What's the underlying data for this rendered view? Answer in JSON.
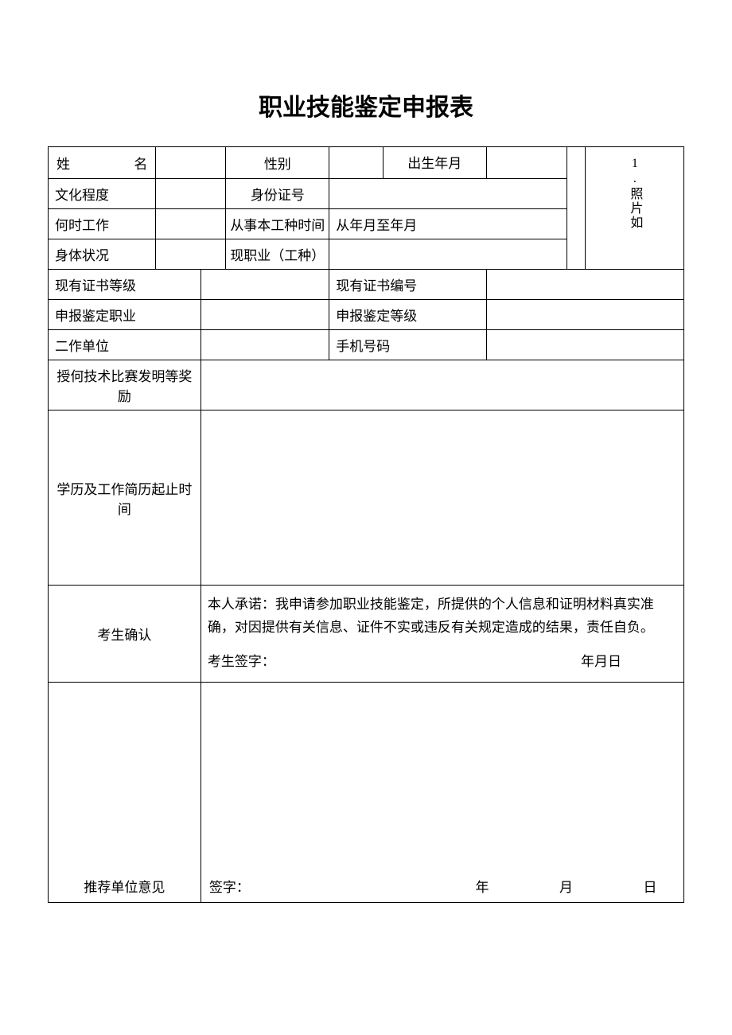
{
  "title": "职业技能鉴定申报表",
  "labels": {
    "name": "姓　　名",
    "gender": "性别",
    "birth": "出生年月",
    "edu_level": "文化程度",
    "id_number": "身份证号",
    "start_work": "何时工作",
    "work_type_period": "从事本工种时间",
    "work_period_value": "从年月至年月",
    "health": "身体状况",
    "current_occupation": "现职业（工种）",
    "cert_level": "现有证书等级",
    "cert_number": "现有证书编号",
    "apply_occupation": "申报鉴定职业",
    "apply_level": "申报鉴定等级",
    "work_unit": "二作单位",
    "phone": "手机号码",
    "awards": "授何技术比赛发明等奖励",
    "resume": "学历及工作简历起止时间",
    "confirm": "考生确认",
    "recommend": "推荐单位意见",
    "photo": "1.照片如"
  },
  "confirm_block": {
    "pledge": "本人承诺：我申请参加职业技能鉴定，所提供的个人信息和证明材料真实准确，对因提供有关信息、证件不实或违反有关规定造成的结果，责任自负。",
    "sign_label": "考生签字：",
    "date_label": "年月日"
  },
  "recommend_block": {
    "sign_label": "签字：",
    "date_year": "年",
    "date_month": "月",
    "date_day": "日"
  },
  "values": {
    "name": "",
    "gender": "",
    "birth": "",
    "edu_level": "",
    "id_number": "",
    "start_work": "",
    "health": "",
    "current_occupation": "",
    "cert_level": "",
    "cert_number": "",
    "apply_occupation": "",
    "apply_level": "",
    "work_unit": "",
    "phone": "",
    "awards": "",
    "resume": ""
  }
}
